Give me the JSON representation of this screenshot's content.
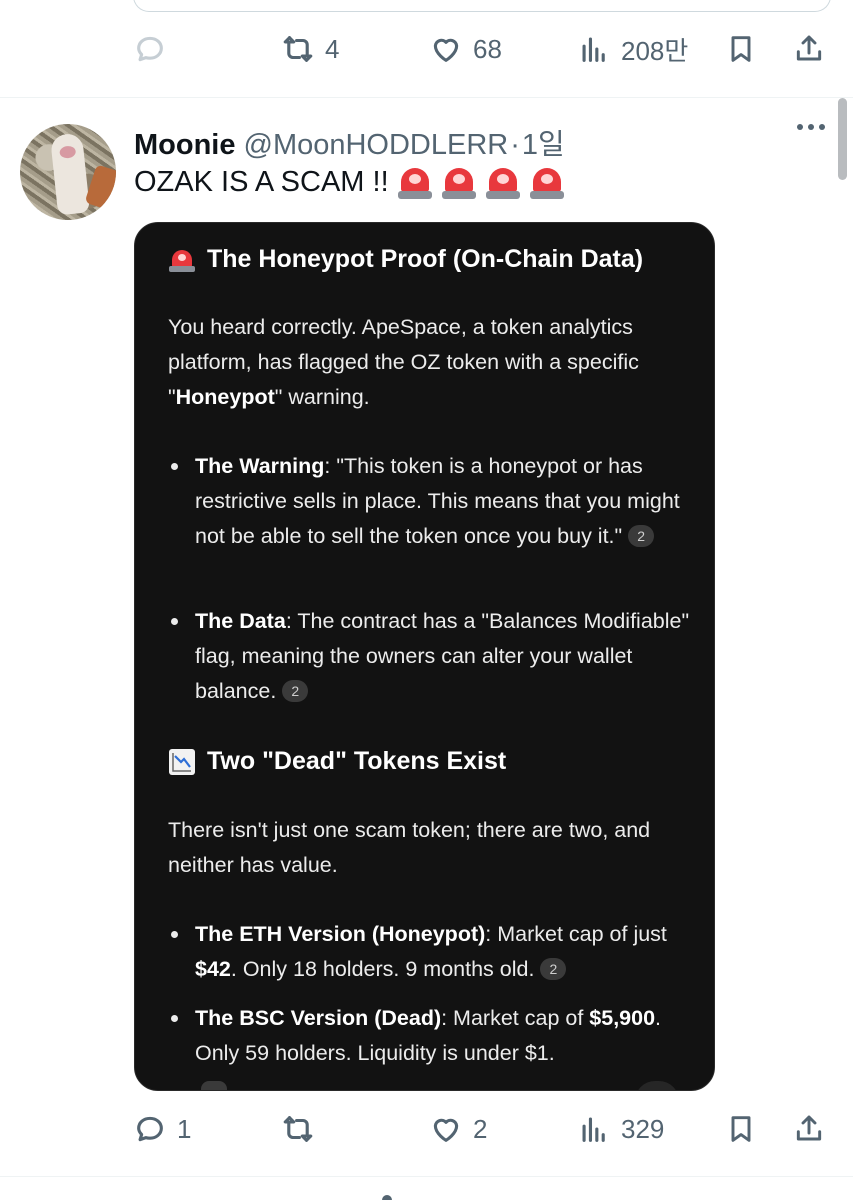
{
  "previous_tweet": {
    "actions": {
      "reply_count": "",
      "retweet_count": "4",
      "like_count": "68",
      "view_count": "208만"
    }
  },
  "tweet": {
    "author_name": "Moonie",
    "author_handle": "@MoonHODDLERR",
    "separator": "·",
    "timestamp": "1일",
    "text": "OZAK IS A SCAM !!",
    "emoji": [
      "siren-emoji",
      "siren-emoji",
      "siren-emoji",
      "siren-emoji"
    ],
    "actions": {
      "reply_count": "1",
      "retweet_count": "",
      "like_count": "2",
      "view_count": "329"
    }
  },
  "media": {
    "section1_title": "The Honeypot Proof (On-Chain Data)",
    "section1_intro_a": "You heard correctly. ApeSpace, a token analytics platform, has flagged the OZ token with a specific \"",
    "section1_intro_bold": "Honeypot",
    "section1_intro_b": "\" warning.",
    "bullet1_label": "The Warning",
    "bullet1_text": ": \"This token is a honeypot or has restrictive sells in place. This means that you might not be able to sell the token once you buy it.\"",
    "bullet1_cite": "2",
    "bullet2_label": "The Data",
    "bullet2_text": ": The contract has a \"Balances Modifiable\" flag, meaning the owners can alter your wallet balance.",
    "bullet2_cite": "2",
    "section2_title": "Two \"Dead\" Tokens Exist",
    "section2_intro": "There isn't just one scam token; there are two, and neither has value.",
    "bullet3_label": "The ETH Version (Honeypot)",
    "bullet3_text_a": ": Market cap of just ",
    "bullet3_bold": "$42",
    "bullet3_text_b": ". Only 18 holders. 9 months old.",
    "bullet3_cite": "2",
    "bullet4_label": "The BSC Version (Dead)",
    "bullet4_text_a": ": Market cap of ",
    "bullet4_bold": "$5,900",
    "bullet4_text_b": ". Only 59 holders. Liquidity is under $1."
  },
  "colors": {
    "text_primary": "#0f1419",
    "text_secondary": "#536471",
    "media_bg": "#121212",
    "siren_red": "#e8383d"
  }
}
